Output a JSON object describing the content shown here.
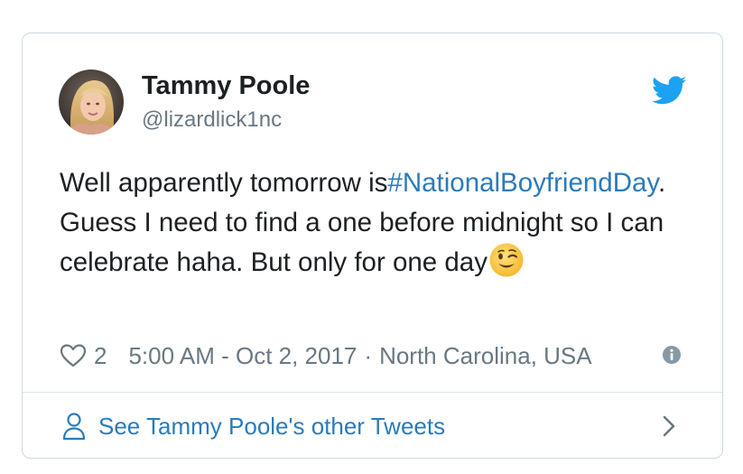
{
  "author": {
    "display_name": "Tammy Poole",
    "handle": "@lizardlick1nc"
  },
  "tweet": {
    "text_before": "Well apparently tomorrow is",
    "hashtag": "#NationalBoyfriendDay",
    "text_after": ". Guess I need to find a one before midnight so I can celebrate haha. But only for one day",
    "emoji": "winking-face"
  },
  "meta": {
    "likes": "2",
    "timestamp": "5:00 AM - Oct 2, 2017",
    "separator": "·",
    "location": "North Carolina, USA"
  },
  "footer": {
    "label": "See Tammy Poole's other Tweets"
  },
  "icons": {
    "brand": "twitter-bird-icon",
    "like": "heart-icon",
    "info": "info-icon",
    "person": "person-icon",
    "chevron": "chevron-right-icon"
  },
  "colors": {
    "brand": "#1da1f2",
    "link": "#2b7bb9",
    "text": "#1c2022",
    "secondary": "#697882",
    "border": "#cfd9de"
  }
}
